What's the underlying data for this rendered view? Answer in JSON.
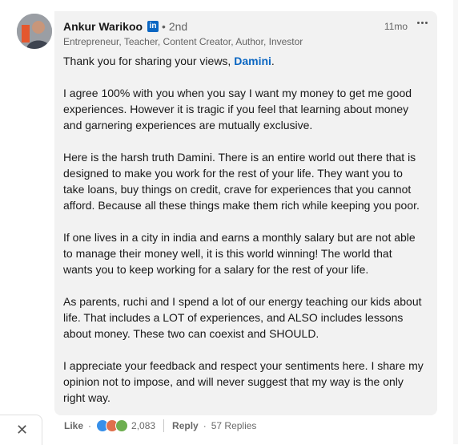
{
  "comment": {
    "author": "Ankur Warikoo",
    "network_badge": "in",
    "degree": "• 2nd",
    "headline": "Entrepreneur, Teacher, Content Creator, Author, Investor",
    "time": "11mo",
    "greeting_prefix": "Thank you for sharing your views, ",
    "mention": "Damini",
    "greeting_suffix": ".",
    "paragraphs": [
      "I agree 100% with you when you say I want my money to get me good experiences. However it is tragic if you feel that learning about money and garnering experiences are mutually exclusive.",
      "Here is the harsh truth Damini. There is an entire world out there that is designed to make you work for the rest of your life. They want you to take loans, buy things on credit, crave for experiences that you cannot afford. Because all these things make them rich while keeping you poor.",
      "If one lives in a city in india and earns a monthly salary but are not able to manage their money well, it is this world winning! The world that wants you to keep working for a salary for the rest of your life.",
      "As parents, ruchi and I spend a lot of our energy teaching our kids about life. That includes a LOT of experiences, and ALSO includes lessons about money. These two can coexist and SHOULD.",
      "I appreciate your feedback and respect your sentiments here. I share my opinion not to impose, and will never suggest that my way is the only right way."
    ]
  },
  "actions": {
    "like_label": "Like",
    "reaction_count": "2,083",
    "reply_label": "Reply",
    "replies_label": "57 Replies"
  },
  "colors": {
    "link": "#0a66c2",
    "bubble": "#f2f2f2"
  }
}
